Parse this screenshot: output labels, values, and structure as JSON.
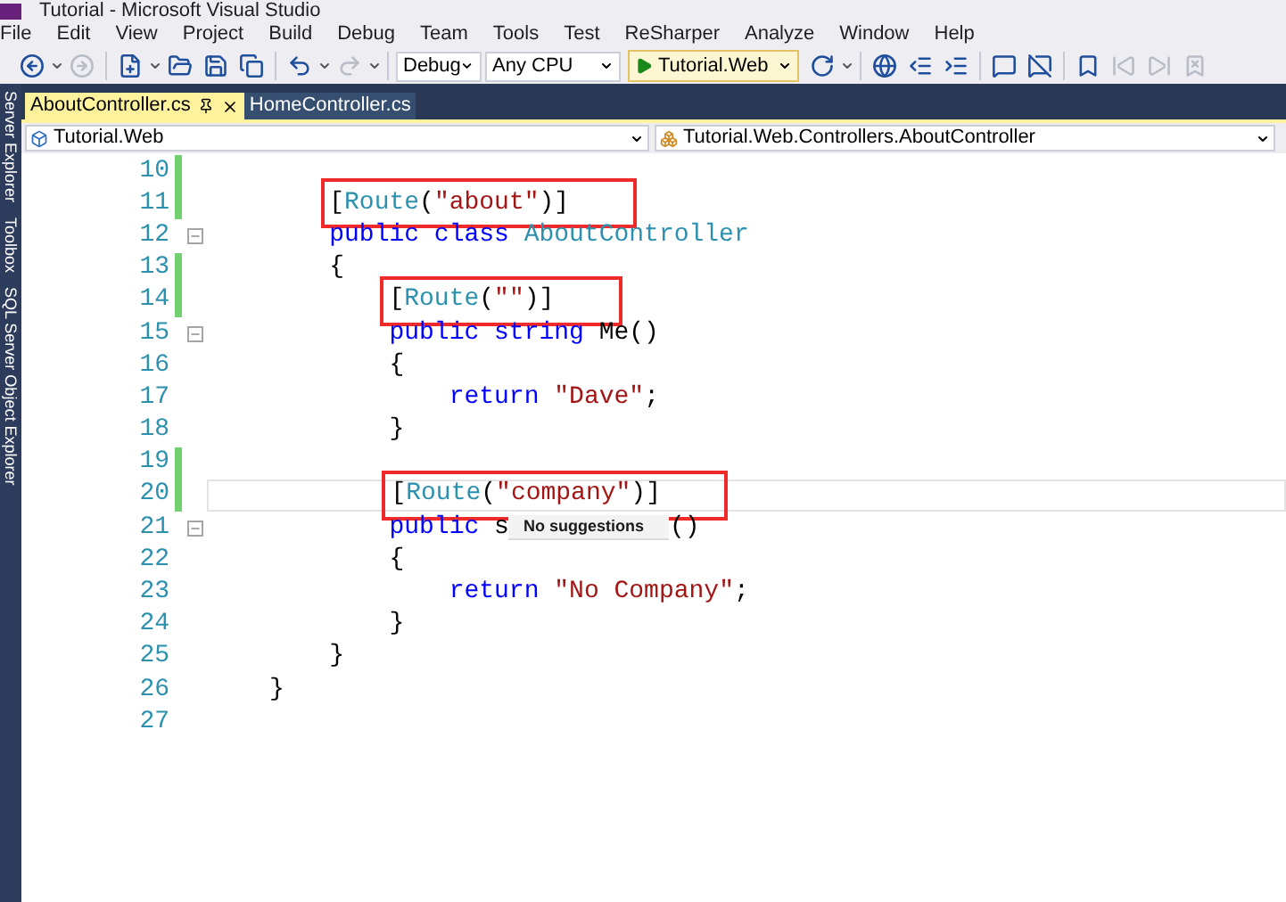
{
  "window": {
    "title": "Tutorial - Microsoft Visual Studio"
  },
  "menu": [
    "File",
    "Edit",
    "View",
    "Project",
    "Build",
    "Debug",
    "Team",
    "Tools",
    "Test",
    "ReSharper",
    "Analyze",
    "Window",
    "Help"
  ],
  "toolbar": [
    {
      "kind": "back"
    },
    {
      "kind": "caret"
    },
    {
      "kind": "forward",
      "disabled": true
    },
    {
      "kind": "sep"
    },
    {
      "kind": "new"
    },
    {
      "kind": "caret"
    },
    {
      "kind": "open"
    },
    {
      "kind": "save"
    },
    {
      "kind": "saveall"
    },
    {
      "kind": "sep"
    },
    {
      "kind": "undo"
    },
    {
      "kind": "caret"
    },
    {
      "kind": "redo",
      "disabled": true
    },
    {
      "kind": "caret"
    },
    {
      "kind": "sep"
    },
    {
      "kind": "dropdown",
      "text": "Debug"
    },
    {
      "kind": "dropdown",
      "text": "Any CPU"
    },
    {
      "kind": "run",
      "text": "Tutorial.Web"
    },
    {
      "kind": "refresh"
    },
    {
      "kind": "caret"
    },
    {
      "kind": "sep"
    },
    {
      "kind": "browser"
    },
    {
      "kind": "outdent"
    },
    {
      "kind": "indent"
    },
    {
      "kind": "sep"
    },
    {
      "kind": "comment"
    },
    {
      "kind": "uncomment"
    },
    {
      "kind": "sep"
    },
    {
      "kind": "bookmark"
    },
    {
      "kind": "prevmark",
      "disabled": true
    },
    {
      "kind": "nextmark",
      "disabled": true
    },
    {
      "kind": "clearmark",
      "disabled": true
    }
  ],
  "side_panels": [
    "Server Explorer",
    "Toolbox",
    "SQL Server Object Explorer"
  ],
  "tabs": [
    {
      "label": "AboutController.cs",
      "selected": true
    },
    {
      "label": "HomeController.cs",
      "selected": false
    }
  ],
  "nav": [
    {
      "text": "Tutorial.Web",
      "kind": "project"
    },
    {
      "text": "Tutorial.Web.Controllers.AboutController",
      "kind": "class"
    }
  ],
  "code": [
    {
      "number": "10",
      "changed": true
    },
    {
      "number": "11",
      "changed": true,
      "highlighted": true,
      "tokens": [
        {
          "kind": "plain",
          "text": "    ["
        },
        {
          "kind": "type",
          "text": "Route"
        },
        {
          "kind": "plain",
          "text": "("
        },
        {
          "kind": "string",
          "text": "\"about\""
        },
        {
          "kind": "plain",
          "text": ")]"
        }
      ]
    },
    {
      "number": "12",
      "foldable": true,
      "tokens": [
        {
          "kind": "keyword",
          "text": "    public class "
        },
        {
          "kind": "type",
          "text": "AboutController"
        }
      ]
    },
    {
      "number": "13",
      "changed": true,
      "tokens": [
        {
          "kind": "plain",
          "text": "    {"
        }
      ]
    },
    {
      "number": "14",
      "changed": true,
      "highlighted": true,
      "tokens": [
        {
          "kind": "plain",
          "text": "        ["
        },
        {
          "kind": "type",
          "text": "Route"
        },
        {
          "kind": "plain",
          "text": "("
        },
        {
          "kind": "string",
          "text": "\"\""
        },
        {
          "kind": "plain",
          "text": ")]"
        }
      ]
    },
    {
      "number": "15",
      "foldable": true,
      "tokens": [
        {
          "kind": "keyword",
          "text": "        public string"
        },
        {
          "kind": "plain",
          "text": " Me()"
        }
      ]
    },
    {
      "number": "16",
      "tokens": [
        {
          "kind": "plain",
          "text": "        {"
        }
      ]
    },
    {
      "number": "17",
      "tokens": [
        {
          "kind": "keyword",
          "text": "            return"
        },
        {
          "kind": "string",
          "text": " \"Dave\""
        },
        {
          "kind": "plain",
          "text": ";"
        }
      ]
    },
    {
      "number": "18",
      "tokens": [
        {
          "kind": "plain",
          "text": "        }"
        }
      ]
    },
    {
      "number": "19",
      "changed": true
    },
    {
      "number": "20",
      "changed": true,
      "highlighted": true,
      "current": true,
      "tokens": [
        {
          "kind": "plain",
          "text": "        ["
        },
        {
          "kind": "type",
          "text": "Route"
        },
        {
          "kind": "plain",
          "text": "("
        },
        {
          "kind": "string",
          "text": "\"company\""
        },
        {
          "kind": "plain",
          "text": ")]"
        }
      ]
    },
    {
      "number": "21",
      "foldable": true,
      "tokens": [
        {
          "kind": "keyword",
          "text": "        public"
        },
        {
          "kind": "plain",
          "text": " s"
        },
        {
          "kind": "popup",
          "text": "No suggestions"
        },
        {
          "kind": "plain",
          "text": "()"
        }
      ]
    },
    {
      "number": "22",
      "tokens": [
        {
          "kind": "plain",
          "text": "        {"
        }
      ]
    },
    {
      "number": "23",
      "tokens": [
        {
          "kind": "keyword",
          "text": "            return"
        },
        {
          "kind": "string",
          "text": " \"No Company\""
        },
        {
          "kind": "plain",
          "text": ";"
        }
      ]
    },
    {
      "number": "24",
      "tokens": [
        {
          "kind": "plain",
          "text": "        }"
        }
      ]
    },
    {
      "number": "25",
      "tokens": [
        {
          "kind": "plain",
          "text": "    }"
        }
      ]
    },
    {
      "number": "26",
      "tokens": [
        {
          "kind": "plain",
          "text": "}"
        }
      ]
    },
    {
      "number": "27"
    }
  ]
}
